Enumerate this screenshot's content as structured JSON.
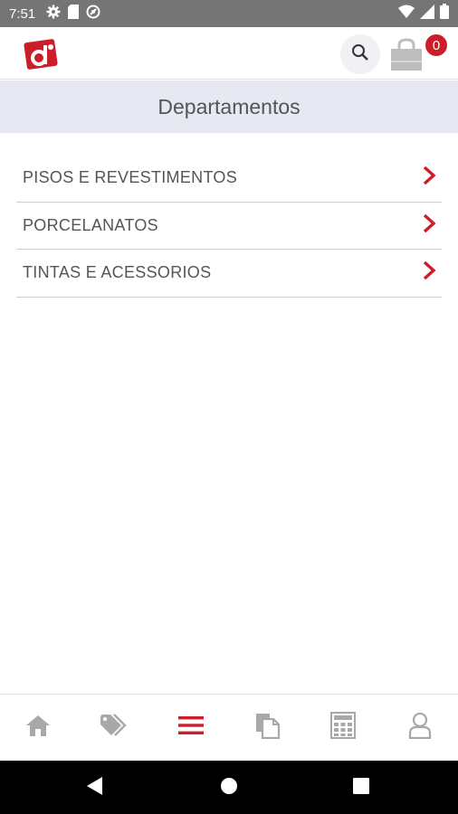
{
  "status_bar": {
    "time": "7:51",
    "left_icons": [
      "gear-icon",
      "sim-card-icon",
      "data-saver-icon"
    ],
    "right_icons": [
      "wifi-icon",
      "cellular-icon",
      "battery-icon"
    ]
  },
  "header": {
    "logo_icon": "brand-logo",
    "search_icon": "search-icon",
    "cart_icon": "shopping-bag-icon",
    "cart_count": "0",
    "accent_color": "#cc1d2a"
  },
  "section": {
    "title": "Departamentos"
  },
  "departments": [
    {
      "label": "PISOS E REVESTIMENTOS",
      "icon": "chevron-right-icon"
    },
    {
      "label": "PORCELANATOS",
      "icon": "chevron-right-icon"
    },
    {
      "label": "TINTAS E ACESSORIOS",
      "icon": "chevron-right-icon"
    }
  ],
  "bottom_nav": {
    "active": "menu",
    "items": [
      "home-icon",
      "tag-icon",
      "menu-icon",
      "documents-icon",
      "calculator-icon",
      "user-icon"
    ]
  },
  "system_nav": [
    "back-icon",
    "home-circle-icon",
    "recents-icon"
  ]
}
